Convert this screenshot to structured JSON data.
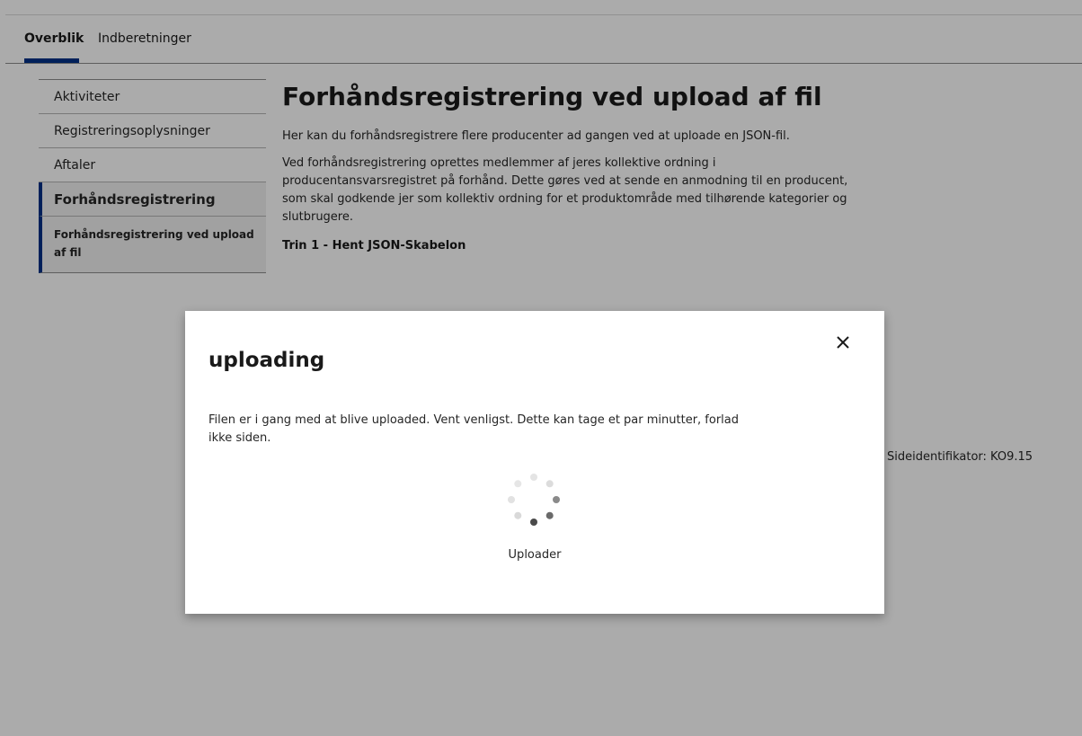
{
  "tabs": [
    {
      "label": "Overblik"
    },
    {
      "label": "Indberetninger"
    }
  ],
  "sidebar": {
    "items": [
      {
        "label": "Aktiviteter"
      },
      {
        "label": "Registreringsoplysninger"
      },
      {
        "label": "Aftaler"
      },
      {
        "label": "Forhåndsregistrering"
      },
      {
        "label": "Forhåndsregistrering ved upload af fil"
      }
    ]
  },
  "main": {
    "title": "Forhåndsregistrering ved upload af fil",
    "intro": "Her kan du forhåndsregistrere flere producenter ad gangen ved at uploade en JSON-fil.",
    "description": "Ved forhåndsregistrering oprettes medlemmer af jeres kollektive ordning i producentansvarsregistret på forhånd. Dette gøres ved at sende en anmodning til en producent, som skal godkende jer som kollektiv ordning for et produktområde med tilhørende kategorier og slutbrugere.",
    "step1_heading": "Trin 1 - Hent JSON-Skabelon",
    "page_id": "Sideidentifikator: KO9.15"
  },
  "modal": {
    "title": "uploading",
    "body": "Filen er i gang med at blive uploaded. Vent venligst. Dette kan tage et par minutter, forlad ikke siden.",
    "spinner_label": "Uploader",
    "close_icon": "close-icon"
  },
  "colors": {
    "accent": "#003087",
    "link": "#1f4aa8",
    "overlay": "rgba(0,0,0,0.33)"
  }
}
